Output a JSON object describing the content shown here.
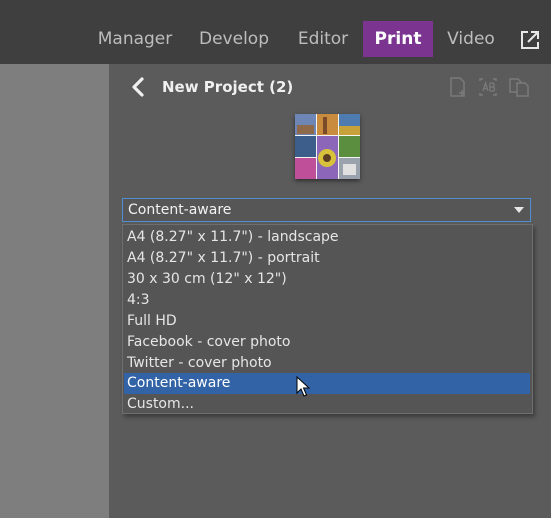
{
  "nav": {
    "tabs": [
      {
        "label": "Manager"
      },
      {
        "label": "Develop"
      },
      {
        "label": "Editor"
      },
      {
        "label": "Print"
      },
      {
        "label": "Video"
      }
    ],
    "active_tab": "Print",
    "external_icon": "external-link-icon"
  },
  "panel": {
    "back_icon": "chevron-left-icon",
    "title": "New Project (2)",
    "tool_icons": [
      "add-page-icon",
      "text-frame-icon",
      "copy-pages-icon"
    ]
  },
  "format_select": {
    "value": "Content-aware",
    "options": [
      "A4 (8.27\" x 11.7\") - landscape",
      "A4 (8.27\" x 11.7\") - portrait",
      "30 x 30 cm (12\" x 12\")",
      "4:3",
      "Full HD",
      "Facebook - cover photo",
      "Twitter - cover photo",
      "Content-aware",
      "Custom..."
    ],
    "highlighted": "Content-aware"
  },
  "colors": {
    "accent": "#7b3590",
    "selection": "#3163a6",
    "focus_border": "#4f8fd0"
  }
}
